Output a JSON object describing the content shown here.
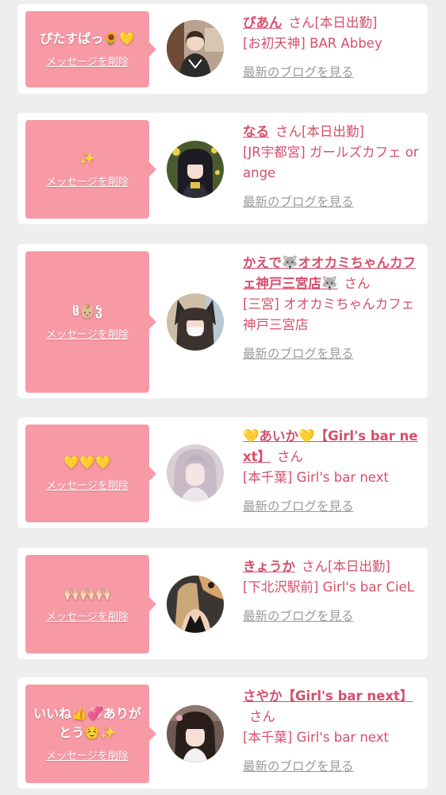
{
  "entries": [
    {
      "message": "ぴたすぱっ🌻💛",
      "delete_label": "メッセージを削除",
      "name": "ぴあん",
      "honorific": "さん",
      "status": "[本日出勤]",
      "shop": "[お初天神] BAR Abbey",
      "blog_label": "最新のブログを見る"
    },
    {
      "message": "✨",
      "delete_label": "メッセージを削除",
      "name": "なる",
      "honorific": "さん",
      "status": "[本日出勤]",
      "shop": "[JR宇都宮] ガールズカフェ orange",
      "blog_label": "最新のブログを見る"
    },
    {
      "message": "ჱ̒👶🏼ჴ",
      "delete_label": "メッセージを削除",
      "name": "かえで🐺オオカミちゃんカフェ神戸三宮店🐺",
      "honorific": "さん",
      "status": "",
      "shop": "[三宮] オオカミちゃんカフェ神戸三宮店",
      "blog_label": "最新のブログを見る"
    },
    {
      "message": "💛💛💛",
      "delete_label": "メッセージを削除",
      "name": "💛あいか💛【Girl's bar next】",
      "honorific": "さん",
      "status": "",
      "shop": "[本千葉] Girl's bar next",
      "blog_label": "最新のブログを見る"
    },
    {
      "message": "🙌🏻🙌🏻🙌🏻",
      "delete_label": "メッセージを削除",
      "name": "きょうか",
      "honorific": "さん",
      "status": "[本日出勤]",
      "shop": "[下北沢駅前] Girl's bar CieL",
      "blog_label": "最新のブログを見る"
    },
    {
      "message": "いいね👍💞ありがとう☺️✨",
      "delete_label": "メッセージを削除",
      "name": "さやか【Girl's bar next】",
      "honorific": "さん",
      "status": "",
      "shop": "[本千葉] Girl's bar next",
      "blog_label": "最新のブログを見る"
    }
  ],
  "colors": {
    "background": "#eeeeee",
    "card": "#ffffff",
    "bubble": "#f89aa6",
    "accent_text": "#d54f6b",
    "muted_text": "#9a9a9a"
  }
}
